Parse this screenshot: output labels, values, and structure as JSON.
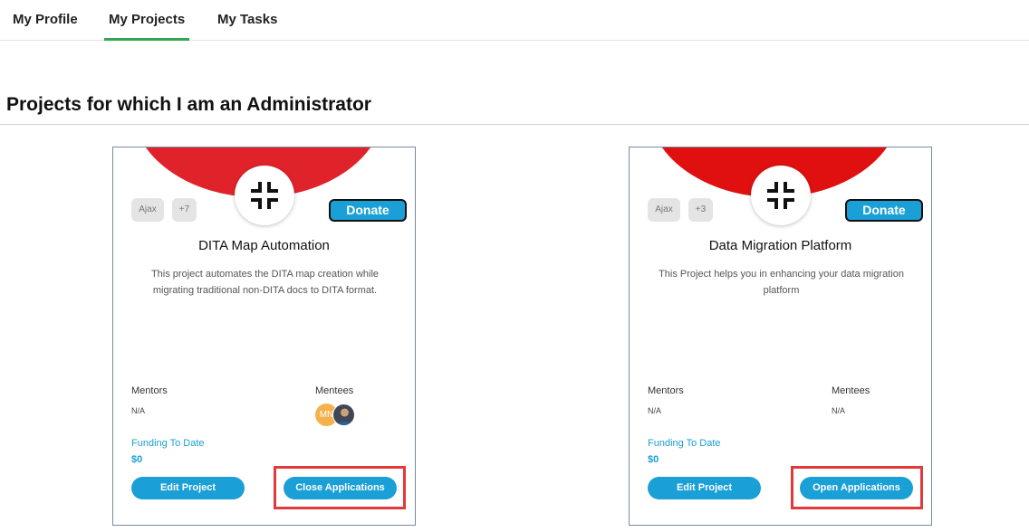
{
  "tabs": [
    "My Profile",
    "My Projects",
    "My Tasks"
  ],
  "active_tab": "My Projects",
  "section_title": "Projects for which I am an Administrator",
  "colors": {
    "accent": "#1a9fd6",
    "tab_active": "#2fa84f",
    "banner": "#e01b1b",
    "highlight": "#e23a3a"
  },
  "projects": [
    {
      "banner_color": "#e0232a",
      "logo_icon": "compress-arrows-icon",
      "tags": [
        "Ajax",
        "+7"
      ],
      "donate_label": "Donate",
      "title": "DITA Map Automation",
      "description": "This project automates the DITA map creation while migrating traditional non-DITA docs to DITA format.",
      "mentors_label": "Mentors",
      "mentors_value": "N/A",
      "mentees_label": "Mentees",
      "mentees_value": "",
      "mentee_avatars": [
        "MN",
        ""
      ],
      "funding_label": "Funding To Date",
      "funding_value": "$0",
      "edit_label": "Edit Project",
      "applications_label": "Close Applications"
    },
    {
      "banner_color": "#e01010",
      "logo_icon": "compress-arrows-icon",
      "tags": [
        "Ajax",
        "+3"
      ],
      "donate_label": "Donate",
      "title": "Data Migration Platform",
      "description": "This Project helps you in enhancing your data migration platform",
      "mentors_label": "Mentors",
      "mentors_value": "N/A",
      "mentees_label": "Mentees",
      "mentees_value": "N/A",
      "mentee_avatars": [],
      "funding_label": "Funding To Date",
      "funding_value": "$0",
      "edit_label": "Edit Project",
      "applications_label": "Open Applications"
    }
  ]
}
